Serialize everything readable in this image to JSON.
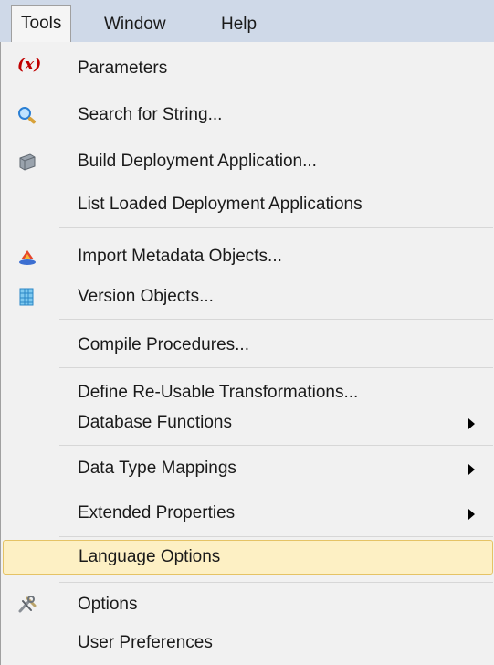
{
  "menubar": {
    "items": [
      {
        "label": "Tools",
        "open": true
      },
      {
        "label": "Window"
      },
      {
        "label": "Help"
      }
    ]
  },
  "menu": {
    "items": [
      {
        "label": "Parameters",
        "icon": "parameters-icon",
        "icon_text": "(x)"
      },
      {
        "label": "Search for String...",
        "icon": "magnifier-icon"
      },
      {
        "label": "Build Deployment Application...",
        "icon": "deployment-icon"
      },
      {
        "label": "List Loaded Deployment Applications"
      },
      {
        "label": "Import Metadata Objects...",
        "icon": "import-icon"
      },
      {
        "label": "Version Objects...",
        "icon": "grid-icon"
      },
      {
        "label": "Compile Procedures..."
      },
      {
        "label": "Define Re-Usable Transformations..."
      },
      {
        "label": "Database Functions",
        "submenu": true
      },
      {
        "label": "Data Type Mappings",
        "submenu": true
      },
      {
        "label": "Extended Properties",
        "submenu": true
      },
      {
        "label": "Language Options",
        "highlighted": true
      },
      {
        "label": "Options",
        "icon": "tools-icon"
      },
      {
        "label": "User Preferences"
      }
    ]
  },
  "colors": {
    "menubar_bg": "#cfd9e8",
    "dropdown_bg": "#f1f1f1",
    "highlight_bg": "#fdf0c4",
    "highlight_border": "#e5c365"
  }
}
